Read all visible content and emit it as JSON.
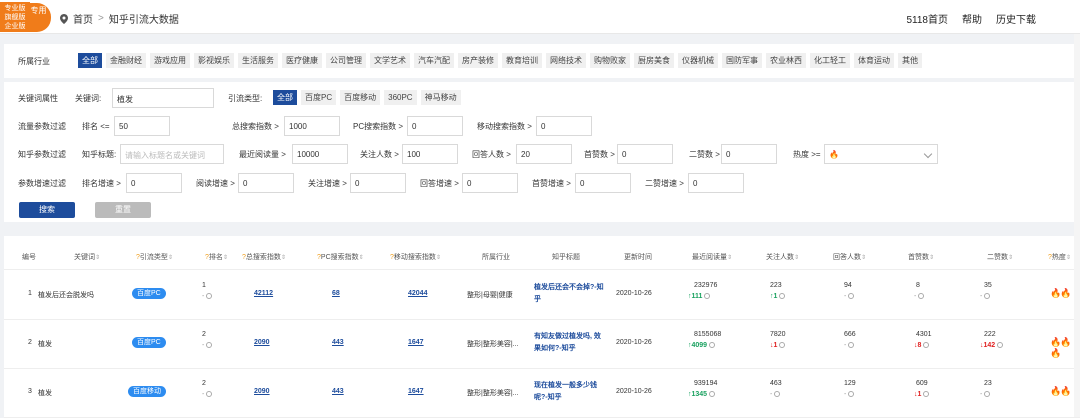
{
  "badge": {
    "lines": [
      "专业版",
      "旗舰版",
      "企业版"
    ],
    "circle": "专用"
  },
  "breadcrumb": {
    "home": "首页",
    "sep": ">",
    "current": "知乎引流大数据"
  },
  "topnav": [
    "5118首页",
    "帮助",
    "历史下载"
  ],
  "industry": {
    "label": "所属行业",
    "items": [
      "全部",
      "金融财经",
      "游戏应用",
      "影视娱乐",
      "生活服务",
      "医疗健康",
      "公司管理",
      "文学艺术",
      "汽车汽配",
      "房产装修",
      "教育培训",
      "网络技术",
      "购物败家",
      "厨房美食",
      "仪器机械",
      "国防军事",
      "农业林西",
      "化工轻工",
      "体育运动",
      "其他"
    ]
  },
  "keyword": {
    "section": "关键词属性",
    "label": "关键词:",
    "value": "植发",
    "type_label": "引流类型:",
    "types": [
      "全部",
      "百度PC",
      "百度移动",
      "360PC",
      "神马移动"
    ]
  },
  "flow": {
    "section": "流量参数过滤",
    "rank_label": "排名 <=",
    "rank": "50",
    "total_label": "总搜索指数 >",
    "total": "1000",
    "pc_label": "PC搜索指数 >",
    "pc": "0",
    "mobile_label": "移动搜索指数 >",
    "mobile": "0"
  },
  "zhihu": {
    "section": "知乎参数过滤",
    "title_label": "知乎标题:",
    "title_placeholder": "请输入标题名或关键词",
    "read_label": "最近阅读量 >",
    "read": "10000",
    "follow_label": "关注人数 >",
    "follow": "100",
    "answer_label": "回答人数 >",
    "answer": "20",
    "first_like_label": "首赞数 >",
    "first_like": "0",
    "second_like_label": "二赞数 >",
    "second_like": "0",
    "heat_label": "热度 >=",
    "heat": "🔥"
  },
  "growth": {
    "section": "参数增速过滤",
    "rank_label": "排名增速 >",
    "rank": "0",
    "read_label": "阅读增速 >",
    "read": "0",
    "follow_label": "关注增速 >",
    "follow": "0",
    "answer_label": "回答增速 >",
    "answer": "0",
    "first_label": "首赞增速 >",
    "first": "0",
    "second_label": "二赞增速 >",
    "second": "0"
  },
  "buttons": {
    "search": "搜索",
    "reset": "重置"
  },
  "table": {
    "headers": [
      "编号",
      "关键词",
      "引流类型",
      "排名",
      "总搜索指数",
      "PC搜索指数",
      "移动搜索指数",
      "所属行业",
      "知乎标题",
      "更新时间",
      "最近阅读量",
      "关注人数",
      "回答人数",
      "首赞数",
      "二赞数",
      "热度"
    ],
    "rows": [
      {
        "no": "1",
        "keyword": "植发后还会脱发吗",
        "type": "百度PC",
        "rank": "1",
        "rank_d": "-",
        "total": "42112",
        "pc": "68",
        "mobile": "42044",
        "industry": "整形|母婴|健康",
        "title": "植发后还会不会掉?-知乎",
        "date": "2020-10-26",
        "read": "232976",
        "read_d": "↑111",
        "follow": "223",
        "follow_d": "↑1",
        "answer": "94",
        "answer_d": "-",
        "first": "8",
        "first_d": "-",
        "second": "35",
        "second_d": "-",
        "heat": "🔥🔥"
      },
      {
        "no": "2",
        "keyword": "植发",
        "type": "百度PC",
        "rank": "2",
        "rank_d": "-",
        "total": "2090",
        "pc": "443",
        "mobile": "1647",
        "industry": "整形|整形美容|...",
        "title": "有知友做过植发吗, 效果如何?-知乎",
        "date": "2020-10-26",
        "read": "8155068",
        "read_d": "↑4099",
        "follow": "7820",
        "follow_d": "↓1",
        "answer": "666",
        "answer_d": "-",
        "first": "4301",
        "first_d": "↓8",
        "second": "222",
        "second_d": "↓142",
        "heat": "🔥🔥🔥"
      },
      {
        "no": "3",
        "keyword": "植发",
        "type": "百度移动",
        "rank": "2",
        "rank_d": "-",
        "total": "2090",
        "pc": "443",
        "mobile": "1647",
        "industry": "整形|整形美容|...",
        "title": "现在植发一般多少钱呢?-知乎",
        "date": "2020-10-26",
        "read": "939194",
        "read_d": "↑1345",
        "follow": "463",
        "follow_d": "-",
        "answer": "129",
        "answer_d": "-",
        "first": "609",
        "first_d": "↓1",
        "second": "23",
        "second_d": "-",
        "heat": "🔥🔥"
      }
    ]
  }
}
